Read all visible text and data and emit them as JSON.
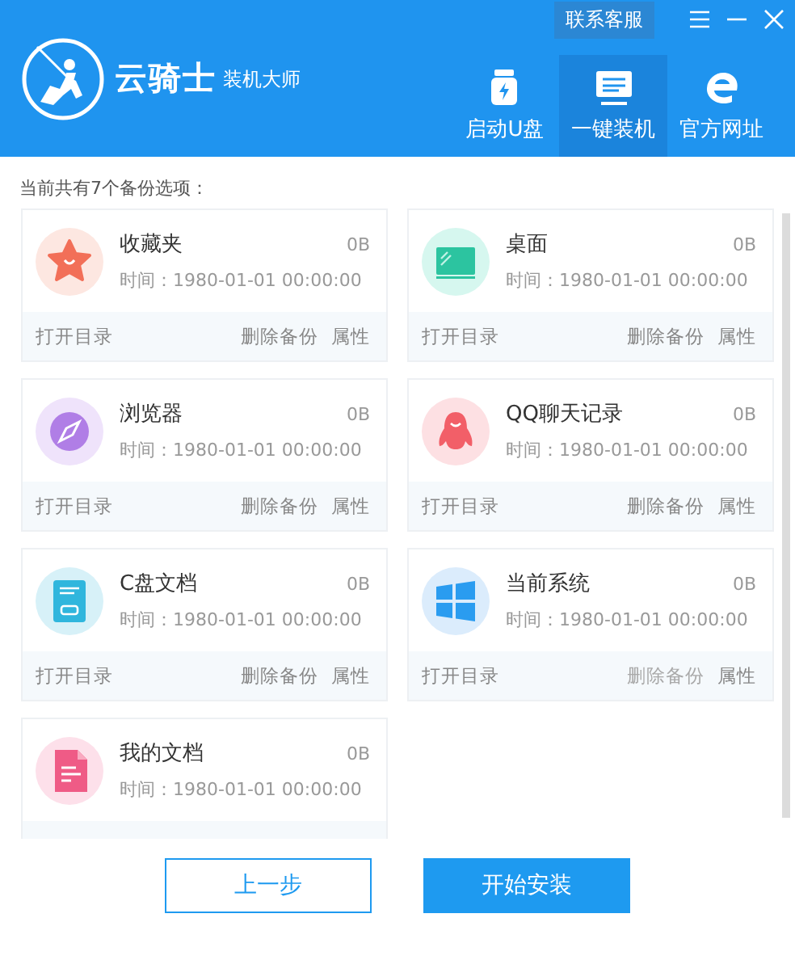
{
  "header": {
    "logo_name": "云骑士",
    "logo_subtitle": "装机大师",
    "service_button": "联系客服",
    "nav": [
      {
        "label": "启动U盘",
        "kind": "usb",
        "selected": false
      },
      {
        "label": "一键装机",
        "kind": "install",
        "selected": true
      },
      {
        "label": "官方网址",
        "kind": "browser",
        "selected": false
      }
    ]
  },
  "summary": "当前共有7个备份选项：",
  "backups": [
    {
      "name": "收藏夹",
      "kind": "star",
      "size": "0B",
      "time": "时间：1980-01-01 00:00:00",
      "open": "打开目录",
      "delete": "删除备份",
      "delete_disabled": false,
      "properties": "属性"
    },
    {
      "name": "桌面",
      "kind": "desktop",
      "size": "0B",
      "time": "时间：1980-01-01 00:00:00",
      "open": "打开目录",
      "delete": "删除备份",
      "delete_disabled": false,
      "properties": "属性"
    },
    {
      "name": "浏览器",
      "kind": "compass",
      "size": "0B",
      "time": "时间：1980-01-01 00:00:00",
      "open": "打开目录",
      "delete": "删除备份",
      "delete_disabled": false,
      "properties": "属性"
    },
    {
      "name": "QQ聊天记录",
      "kind": "chat",
      "size": "0B",
      "time": "时间：1980-01-01 00:00:00",
      "open": "打开目录",
      "delete": "删除备份",
      "delete_disabled": false,
      "properties": "属性"
    },
    {
      "name": "C盘文档",
      "kind": "drive",
      "size": "0B",
      "time": "时间：1980-01-01 00:00:00",
      "open": "打开目录",
      "delete": "删除备份",
      "delete_disabled": false,
      "properties": "属性"
    },
    {
      "name": "当前系统",
      "kind": "windows",
      "size": "0B",
      "time": "时间：1980-01-01 00:00:00",
      "open": "打开目录",
      "delete": "删除备份",
      "delete_disabled": true,
      "properties": "属性"
    },
    {
      "name": "我的文档",
      "kind": "document",
      "size": "0B",
      "time": "时间：1980-01-01 00:00:00"
    }
  ],
  "buttons": {
    "back": "上一步",
    "start": "开始安装"
  }
}
